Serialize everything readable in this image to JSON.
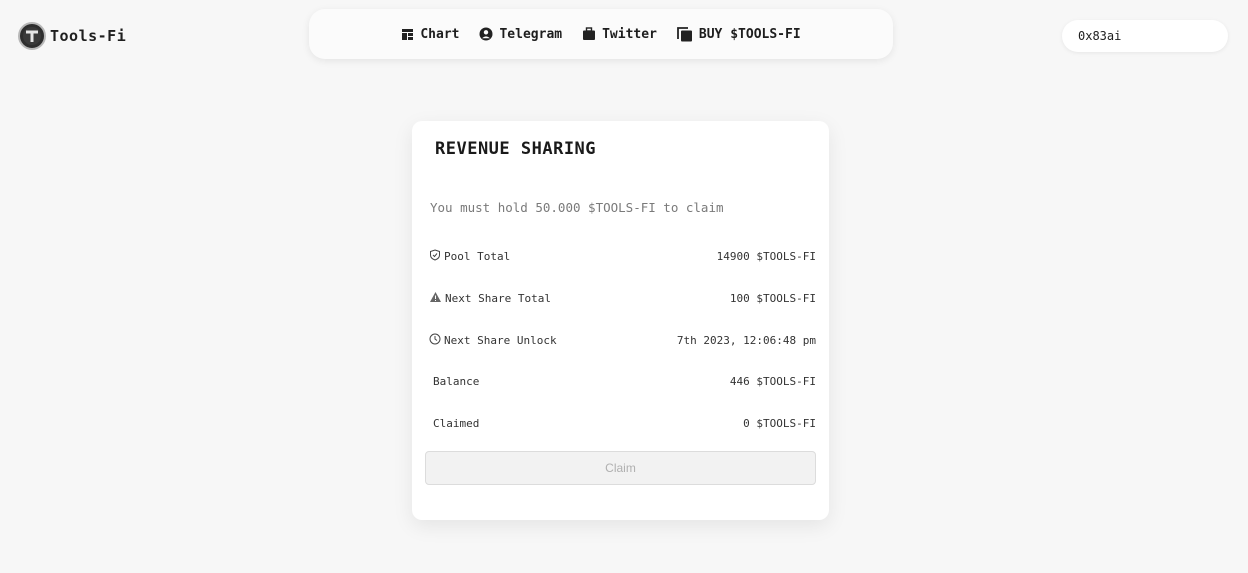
{
  "brand": {
    "name": "Tools-Fi"
  },
  "nav": {
    "items": [
      {
        "label": "Chart",
        "icon": "chart-icon"
      },
      {
        "label": "Telegram",
        "icon": "user-circle-icon"
      },
      {
        "label": "Twitter",
        "icon": "briefcase-icon"
      },
      {
        "label": "BUY $TOOLS-FI",
        "icon": "copy-icon"
      }
    ]
  },
  "wallet": {
    "address": "0x83ai"
  },
  "card": {
    "title": "REVENUE SHARING",
    "notice": "You must hold 50.000 $TOOLS-FI to claim",
    "rows": [
      {
        "label": "Pool Total",
        "value": "14900 $TOOLS-FI",
        "icon": "shield-icon"
      },
      {
        "label": "Next Share Total",
        "value": "100 $TOOLS-FI",
        "icon": "warning-triangle-icon"
      },
      {
        "label": "Next Share Unlock",
        "value": "7th 2023, 12:06:48 pm",
        "icon": "clock-icon"
      },
      {
        "label": "Balance",
        "value": "446 $TOOLS-FI"
      },
      {
        "label": "Claimed",
        "value": "0 $TOOLS-FI"
      }
    ],
    "claim_label": "Claim"
  },
  "colors": {
    "background": "#f7f7f7",
    "card": "#ffffff",
    "text": "#222222",
    "muted": "#7a7a7a",
    "disabled_button": "#f2f2f2"
  }
}
